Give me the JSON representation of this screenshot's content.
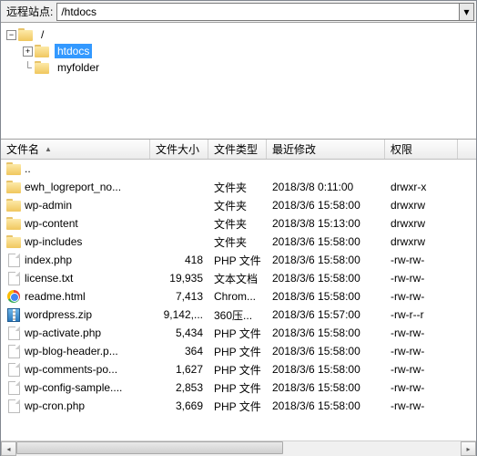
{
  "topbar": {
    "label": "远程站点:",
    "path": "/htdocs"
  },
  "tree": {
    "root": "/",
    "items": [
      {
        "name": "htdocs",
        "selected": true,
        "expandable": true
      },
      {
        "name": "myfolder",
        "selected": false,
        "expandable": false
      }
    ]
  },
  "columns": {
    "name": "文件名",
    "size": "文件大小",
    "type": "文件类型",
    "modified": "最近修改",
    "perm": "权限"
  },
  "rows": [
    {
      "icon": "folder",
      "name": "..",
      "size": "",
      "type": "",
      "modified": "",
      "perm": ""
    },
    {
      "icon": "folder",
      "name": "ewh_logreport_no...",
      "size": "",
      "type": "文件夹",
      "modified": "2018/3/8 0:11:00",
      "perm": "drwxr-x"
    },
    {
      "icon": "folder",
      "name": "wp-admin",
      "size": "",
      "type": "文件夹",
      "modified": "2018/3/6 15:58:00",
      "perm": "drwxrw"
    },
    {
      "icon": "folder",
      "name": "wp-content",
      "size": "",
      "type": "文件夹",
      "modified": "2018/3/8 15:13:00",
      "perm": "drwxrw"
    },
    {
      "icon": "folder",
      "name": "wp-includes",
      "size": "",
      "type": "文件夹",
      "modified": "2018/3/6 15:58:00",
      "perm": "drwxrw"
    },
    {
      "icon": "file",
      "name": "index.php",
      "size": "418",
      "type": "PHP 文件",
      "modified": "2018/3/6 15:58:00",
      "perm": "-rw-rw-"
    },
    {
      "icon": "file",
      "name": "license.txt",
      "size": "19,935",
      "type": "文本文档",
      "modified": "2018/3/6 15:58:00",
      "perm": "-rw-rw-"
    },
    {
      "icon": "chrome",
      "name": "readme.html",
      "size": "7,413",
      "type": "Chrom...",
      "modified": "2018/3/6 15:58:00",
      "perm": "-rw-rw-"
    },
    {
      "icon": "zip",
      "name": "wordpress.zip",
      "size": "9,142,...",
      "type": "360压...",
      "modified": "2018/3/6 15:57:00",
      "perm": "-rw-r--r"
    },
    {
      "icon": "file",
      "name": "wp-activate.php",
      "size": "5,434",
      "type": "PHP 文件",
      "modified": "2018/3/6 15:58:00",
      "perm": "-rw-rw-"
    },
    {
      "icon": "file",
      "name": "wp-blog-header.p...",
      "size": "364",
      "type": "PHP 文件",
      "modified": "2018/3/6 15:58:00",
      "perm": "-rw-rw-"
    },
    {
      "icon": "file",
      "name": "wp-comments-po...",
      "size": "1,627",
      "type": "PHP 文件",
      "modified": "2018/3/6 15:58:00",
      "perm": "-rw-rw-"
    },
    {
      "icon": "file",
      "name": "wp-config-sample....",
      "size": "2,853",
      "type": "PHP 文件",
      "modified": "2018/3/6 15:58:00",
      "perm": "-rw-rw-"
    },
    {
      "icon": "file",
      "name": "wp-cron.php",
      "size": "3,669",
      "type": "PHP 文件",
      "modified": "2018/3/6 15:58:00",
      "perm": "-rw-rw-"
    }
  ]
}
